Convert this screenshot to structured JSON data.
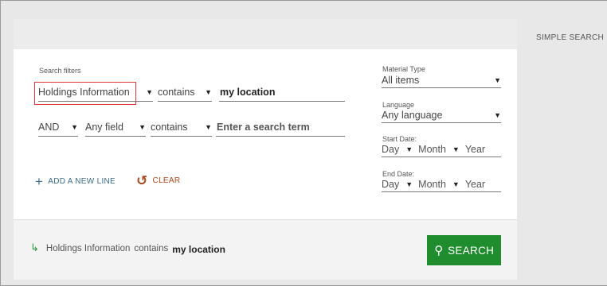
{
  "header": {
    "simple_search": "SIMPLE SEARCH"
  },
  "filters": {
    "label": "Search filters",
    "rows": [
      {
        "operator": "",
        "field": "Holdings Information",
        "condition": "contains",
        "value": "my location",
        "placeholder": ""
      },
      {
        "operator": "AND",
        "field": "Any field",
        "condition": "contains",
        "value": "",
        "placeholder": "Enter a search term"
      }
    ],
    "add_line": "ADD A NEW LINE",
    "clear": "CLEAR"
  },
  "right": {
    "material_type_label": "Material Type",
    "material_type_value": "All items",
    "language_label": "Language",
    "language_value": "Any language",
    "start_date_label": "Start Date:",
    "end_date_label": "End Date:",
    "day": "Day",
    "month": "Month",
    "year": "Year"
  },
  "summary": {
    "field": "Holdings Information",
    "condition": "contains",
    "value": "my location"
  },
  "search_button": "SEARCH",
  "colors": {
    "accent_green": "#1f8c2e",
    "link_blue": "#3a6b8a",
    "clear_orange": "#b0461b",
    "highlight_red": "#e0373a"
  },
  "icons": {
    "add": "plus-icon",
    "clear": "undo-icon",
    "summary": "arrow-return-icon",
    "search": "search-icon"
  }
}
